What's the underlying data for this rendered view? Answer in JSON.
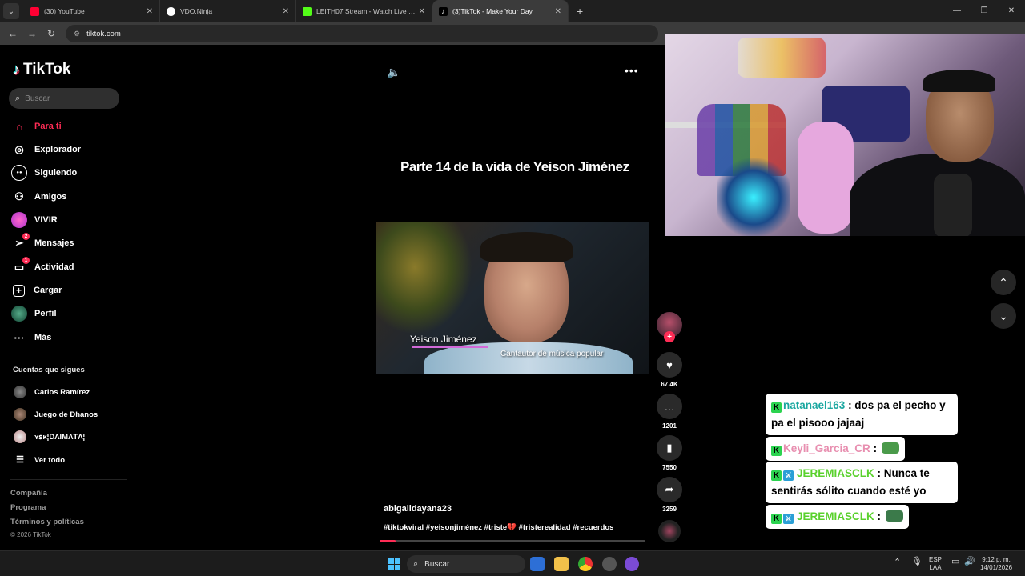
{
  "browser": {
    "tabs": [
      {
        "title": "(30) YouTube",
        "color": "#ff0033"
      },
      {
        "title": "VDO.Ninja",
        "color": "#ffffff"
      },
      {
        "title": "LEITH07 Stream - Watch Live on Kick",
        "color": "#53fc18"
      },
      {
        "title": "(3)TikTok - Make Your Day",
        "color": "#111111"
      }
    ],
    "url": "tiktok.com"
  },
  "tiktok": {
    "brand": "TikTok",
    "search_placeholder": "Buscar",
    "nav": [
      {
        "label": "Para ti",
        "icon": "home-icon",
        "active": true
      },
      {
        "label": "Explorador",
        "icon": "compass-icon"
      },
      {
        "label": "Siguiendo",
        "icon": "following-icon"
      },
      {
        "label": "Amigos",
        "icon": "friends-icon"
      },
      {
        "label": "VIVIR",
        "icon": "live-icon"
      },
      {
        "label": "Mensajes",
        "icon": "messages-icon",
        "badge": "2"
      },
      {
        "label": "Actividad",
        "icon": "activity-icon",
        "badge": "1"
      },
      {
        "label": "Cargar",
        "icon": "upload-icon"
      },
      {
        "label": "Perfil",
        "icon": "profile-icon"
      },
      {
        "label": "Más",
        "icon": "more-icon"
      }
    ],
    "following_title": "Cuentas que sigues",
    "following": [
      {
        "name": "Carlos Ramírez"
      },
      {
        "name": "Juego de Dhanos"
      },
      {
        "name": "ʏꜱᴋ¦DΛIMΛTΛ¦"
      }
    ],
    "see_all": "Ver todo",
    "footer": [
      "Compañía",
      "Programa",
      "Términos y políticas"
    ],
    "copyright": "© 2026 TikTok"
  },
  "video": {
    "overlay_title": "Parte 14 de la vida de Yeison Jiménez",
    "caption_name": "Yeison Jiménez",
    "caption_role": "Cantautor de música popular",
    "author": "abigaildayana23",
    "hashtags": "#tiktokviral #yeisonjiménez #triste💔 #tristerealidad #recuerdos",
    "likes": "67.4K",
    "comments": "1201",
    "saves": "7550",
    "shares": "3259",
    "progress": 0.06
  },
  "chat": [
    {
      "user": "natanael163",
      "user_color": "#1aa7a0",
      "text": ": dos pa el pecho y pa el pisooo jajaaj",
      "mod": false
    },
    {
      "user": "Keyli_Garcia_CR",
      "user_color": "#e88fb0",
      "text": ": ",
      "mod": false,
      "emote": true
    },
    {
      "user": "JEREMIASCLK",
      "user_color": "#5ad12d",
      "text": ": Nunca te sentirás sólito cuando esté yo",
      "mod": true
    },
    {
      "user": "JEREMIASCLK",
      "user_color": "#5ad12d",
      "text": ": ",
      "mod": true,
      "emote": true
    }
  ],
  "taskbar": {
    "search": "Buscar",
    "lang_top": "ESP",
    "lang_bottom": "LAA",
    "time": "9:12 p. m.",
    "date": "14/01/2026"
  }
}
